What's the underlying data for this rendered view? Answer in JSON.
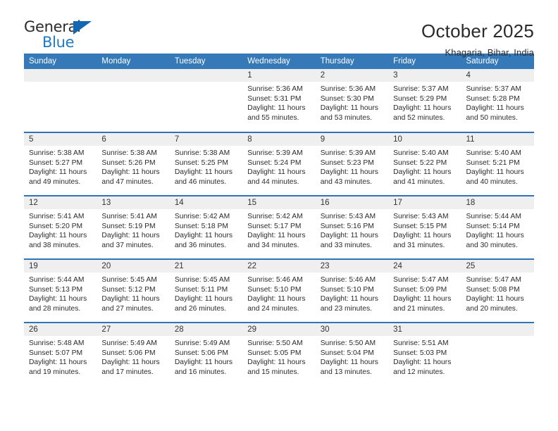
{
  "logo": {
    "word_top": "General",
    "word_bottom": "Blue",
    "triangle_color": "#1268b3",
    "blue_text_color": "#1e7ac4"
  },
  "header": {
    "title": "October 2025",
    "subtitle": "Khagaria, Bihar, India"
  },
  "theme": {
    "header_bg": "#3579b8",
    "row_border": "#2f74b5",
    "daynum_bg": "#efefef"
  },
  "calendar": {
    "weekday_headers": [
      "Sunday",
      "Monday",
      "Tuesday",
      "Wednesday",
      "Thursday",
      "Friday",
      "Saturday"
    ],
    "weeks": [
      [
        {
          "day": "",
          "lines": []
        },
        {
          "day": "",
          "lines": []
        },
        {
          "day": "",
          "lines": []
        },
        {
          "day": "1",
          "lines": [
            "Sunrise: 5:36 AM",
            "Sunset: 5:31 PM",
            "Daylight: 11 hours",
            "and 55 minutes."
          ]
        },
        {
          "day": "2",
          "lines": [
            "Sunrise: 5:36 AM",
            "Sunset: 5:30 PM",
            "Daylight: 11 hours",
            "and 53 minutes."
          ]
        },
        {
          "day": "3",
          "lines": [
            "Sunrise: 5:37 AM",
            "Sunset: 5:29 PM",
            "Daylight: 11 hours",
            "and 52 minutes."
          ]
        },
        {
          "day": "4",
          "lines": [
            "Sunrise: 5:37 AM",
            "Sunset: 5:28 PM",
            "Daylight: 11 hours",
            "and 50 minutes."
          ]
        }
      ],
      [
        {
          "day": "5",
          "lines": [
            "Sunrise: 5:38 AM",
            "Sunset: 5:27 PM",
            "Daylight: 11 hours",
            "and 49 minutes."
          ]
        },
        {
          "day": "6",
          "lines": [
            "Sunrise: 5:38 AM",
            "Sunset: 5:26 PM",
            "Daylight: 11 hours",
            "and 47 minutes."
          ]
        },
        {
          "day": "7",
          "lines": [
            "Sunrise: 5:38 AM",
            "Sunset: 5:25 PM",
            "Daylight: 11 hours",
            "and 46 minutes."
          ]
        },
        {
          "day": "8",
          "lines": [
            "Sunrise: 5:39 AM",
            "Sunset: 5:24 PM",
            "Daylight: 11 hours",
            "and 44 minutes."
          ]
        },
        {
          "day": "9",
          "lines": [
            "Sunrise: 5:39 AM",
            "Sunset: 5:23 PM",
            "Daylight: 11 hours",
            "and 43 minutes."
          ]
        },
        {
          "day": "10",
          "lines": [
            "Sunrise: 5:40 AM",
            "Sunset: 5:22 PM",
            "Daylight: 11 hours",
            "and 41 minutes."
          ]
        },
        {
          "day": "11",
          "lines": [
            "Sunrise: 5:40 AM",
            "Sunset: 5:21 PM",
            "Daylight: 11 hours",
            "and 40 minutes."
          ]
        }
      ],
      [
        {
          "day": "12",
          "lines": [
            "Sunrise: 5:41 AM",
            "Sunset: 5:20 PM",
            "Daylight: 11 hours",
            "and 38 minutes."
          ]
        },
        {
          "day": "13",
          "lines": [
            "Sunrise: 5:41 AM",
            "Sunset: 5:19 PM",
            "Daylight: 11 hours",
            "and 37 minutes."
          ]
        },
        {
          "day": "14",
          "lines": [
            "Sunrise: 5:42 AM",
            "Sunset: 5:18 PM",
            "Daylight: 11 hours",
            "and 36 minutes."
          ]
        },
        {
          "day": "15",
          "lines": [
            "Sunrise: 5:42 AM",
            "Sunset: 5:17 PM",
            "Daylight: 11 hours",
            "and 34 minutes."
          ]
        },
        {
          "day": "16",
          "lines": [
            "Sunrise: 5:43 AM",
            "Sunset: 5:16 PM",
            "Daylight: 11 hours",
            "and 33 minutes."
          ]
        },
        {
          "day": "17",
          "lines": [
            "Sunrise: 5:43 AM",
            "Sunset: 5:15 PM",
            "Daylight: 11 hours",
            "and 31 minutes."
          ]
        },
        {
          "day": "18",
          "lines": [
            "Sunrise: 5:44 AM",
            "Sunset: 5:14 PM",
            "Daylight: 11 hours",
            "and 30 minutes."
          ]
        }
      ],
      [
        {
          "day": "19",
          "lines": [
            "Sunrise: 5:44 AM",
            "Sunset: 5:13 PM",
            "Daylight: 11 hours",
            "and 28 minutes."
          ]
        },
        {
          "day": "20",
          "lines": [
            "Sunrise: 5:45 AM",
            "Sunset: 5:12 PM",
            "Daylight: 11 hours",
            "and 27 minutes."
          ]
        },
        {
          "day": "21",
          "lines": [
            "Sunrise: 5:45 AM",
            "Sunset: 5:11 PM",
            "Daylight: 11 hours",
            "and 26 minutes."
          ]
        },
        {
          "day": "22",
          "lines": [
            "Sunrise: 5:46 AM",
            "Sunset: 5:10 PM",
            "Daylight: 11 hours",
            "and 24 minutes."
          ]
        },
        {
          "day": "23",
          "lines": [
            "Sunrise: 5:46 AM",
            "Sunset: 5:10 PM",
            "Daylight: 11 hours",
            "and 23 minutes."
          ]
        },
        {
          "day": "24",
          "lines": [
            "Sunrise: 5:47 AM",
            "Sunset: 5:09 PM",
            "Daylight: 11 hours",
            "and 21 minutes."
          ]
        },
        {
          "day": "25",
          "lines": [
            "Sunrise: 5:47 AM",
            "Sunset: 5:08 PM",
            "Daylight: 11 hours",
            "and 20 minutes."
          ]
        }
      ],
      [
        {
          "day": "26",
          "lines": [
            "Sunrise: 5:48 AM",
            "Sunset: 5:07 PM",
            "Daylight: 11 hours",
            "and 19 minutes."
          ]
        },
        {
          "day": "27",
          "lines": [
            "Sunrise: 5:49 AM",
            "Sunset: 5:06 PM",
            "Daylight: 11 hours",
            "and 17 minutes."
          ]
        },
        {
          "day": "28",
          "lines": [
            "Sunrise: 5:49 AM",
            "Sunset: 5:06 PM",
            "Daylight: 11 hours",
            "and 16 minutes."
          ]
        },
        {
          "day": "29",
          "lines": [
            "Sunrise: 5:50 AM",
            "Sunset: 5:05 PM",
            "Daylight: 11 hours",
            "and 15 minutes."
          ]
        },
        {
          "day": "30",
          "lines": [
            "Sunrise: 5:50 AM",
            "Sunset: 5:04 PM",
            "Daylight: 11 hours",
            "and 13 minutes."
          ]
        },
        {
          "day": "31",
          "lines": [
            "Sunrise: 5:51 AM",
            "Sunset: 5:03 PM",
            "Daylight: 11 hours",
            "and 12 minutes."
          ]
        },
        {
          "day": "",
          "lines": []
        }
      ]
    ]
  }
}
